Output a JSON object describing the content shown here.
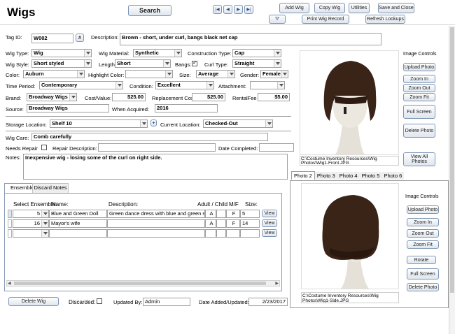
{
  "header": {
    "title": "Wigs",
    "search_label": "Search",
    "nav": [
      "first-record",
      "previous-record",
      "next-record",
      "last-record"
    ],
    "buttons": {
      "add_wig": "Add Wig",
      "copy_wig": "Copy Wig",
      "utilities": "Utilities",
      "save_close": "Save and Close",
      "print_wig": "Print Wig Record",
      "refresh": "Refresh Lookups"
    }
  },
  "form": {
    "tag_id_label": "Tag ID:",
    "tag_id": "W002",
    "tag_btn": "#",
    "description_label": "Description:",
    "description": "Brown - short, under curl, bangs  black net cap",
    "wig_type_label": "Wig Type:",
    "wig_type": "Wig",
    "wig_material_label": "Wig Material:",
    "wig_material": "Synthetic",
    "construction_type_label": "Construction Type:",
    "construction_type": "Cap",
    "wig_style_label": "Wig Style:",
    "wig_style": "Short styled",
    "length_label": "Length:",
    "length": "Short",
    "bangs_label": "Bangs:",
    "bangs_checked": true,
    "curl_type_label": "Curl Type:",
    "curl_type": "Straight",
    "color_label": "Color:",
    "color": "Auburn",
    "highlight_color_label": "Highlight Color:",
    "highlight_color": "",
    "size_label": "Size:",
    "size": "Average",
    "gender_label": "Gender:",
    "gender": "Female",
    "time_period_label": "Time Period:",
    "time_period": "Contemporary",
    "condition_label": "Condition:",
    "condition": "Excellent",
    "attachment_label": "Attachment:",
    "attachment": "",
    "brand_label": "Brand:",
    "brand": "Broadway Wigs",
    "cost_label": "Cost/Value:",
    "cost": "$25.00",
    "replacement_label": "Replacement Cost:",
    "replacement": "$25.00",
    "rental_label": "RentalFee",
    "rental": "$5.00",
    "source_label": "Source:",
    "source": "Broadway Wigs",
    "when_acquired_label": "When Acquired:",
    "when_acquired": "2016",
    "storage_location_label": "Storage Location:",
    "storage_location": "Shelf 10",
    "storage_add": "+",
    "current_location_label": "Current Location:",
    "current_location": "Checked-Out",
    "wig_care_label": "Wig Care:",
    "wig_care": "Comb carefully",
    "needs_repair_label": "Needs Repair",
    "repair_description_label": "Repair Description:",
    "repair_description": "",
    "date_completed_label": "Date Completed:",
    "date_completed": "",
    "notes_label": "Notes:",
    "notes": "Inexpensive wig - losing some of the curl on right side."
  },
  "subtabs": [
    "Ensembles",
    "Discard Notes"
  ],
  "ensembles": {
    "columns": [
      "Select Ensemble:",
      "Name:",
      "Description:",
      "Adult / Child",
      "M/F",
      "Size:"
    ],
    "rows": [
      {
        "num": "5",
        "name": "Blue and Green Doll",
        "description": "Green dance dress with blue and green ski",
        "ac": "A",
        "mf": "F",
        "size": "5",
        "view": "View"
      },
      {
        "num": "16",
        "name": "Mayor's wife",
        "description": "",
        "ac": "A",
        "mf": "F",
        "size": "14",
        "view": "View"
      },
      {
        "num": "",
        "name": "",
        "description": "",
        "ac": "",
        "mf": "",
        "size": "",
        "view": "View"
      }
    ]
  },
  "footer": {
    "delete_wig": "Delete Wig",
    "discarded_label": "Discarded:",
    "updated_by_label": "Updated By:",
    "updated_by": "Admin",
    "date_added_label": "Date Added/Updated:",
    "date_added": "2/23/2017"
  },
  "photo1": {
    "controls_title": "Image Controls",
    "buttons": [
      "Upload Photo",
      "Zoom In",
      "Zoom Out",
      "Zoom Fit",
      "Full Screen",
      "Delete Photo"
    ],
    "path": "C:\\Costume Inventory Resources\\Wig Photos\\Wig1-Front.JPG",
    "view_all": "View All Photos"
  },
  "photo_tabs": [
    "Photo 2",
    "Photo 3",
    "Photo 4",
    "Photo 5",
    "Photo 6"
  ],
  "photo2": {
    "controls_title": "Image Controls",
    "buttons": [
      "Upload Photo",
      "Zoom In",
      "Zoom Out",
      "Zoom Fit",
      "Rotate",
      "Full Screen",
      "Delete Photo"
    ],
    "path": "C:\\Costume Inventory Resources\\Wig Photos\\Wig1-Side.JPG"
  },
  "colors": {
    "accent_border": "#7c94b4",
    "hair": "#3a2418",
    "head": "#e9e4dc"
  }
}
